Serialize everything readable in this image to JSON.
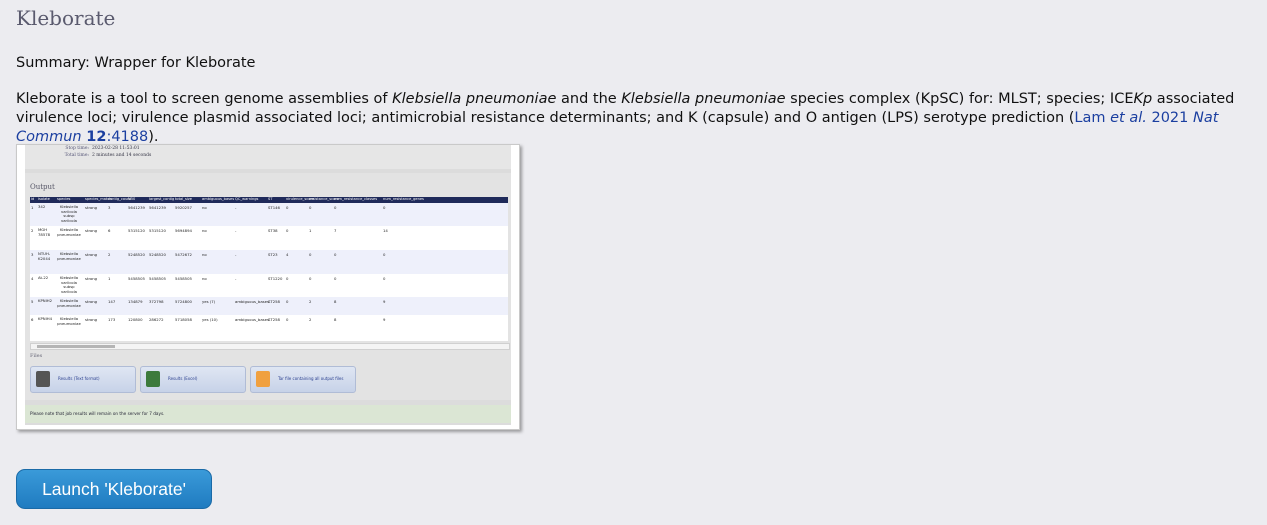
{
  "page": {
    "title": "Kleborate",
    "summary": "Summary: Wrapper for Kleborate",
    "description": {
      "p1": "Kleborate is a tool to screen genome assemblies of ",
      "i1": "Klebsiella pneumoniae",
      "p2": " and the ",
      "i2": "Klebsiella pneumoniae",
      "p3": " species complex (KpSC) for: MLST; species; ICE",
      "i3": "Kp",
      "p4": " associated virulence loci; virulence plasmid associated loci; antimicrobial resistance determinants; and K (capsule) and O antigen (LPS) serotype prediction (",
      "ref_a": "Lam ",
      "ref_b": "et al.",
      "ref_c": " 2021 ",
      "ref_d": "Nat Commun",
      "ref_e": " ",
      "ref_f": "12",
      "ref_g": ":4188",
      "p5": ")."
    },
    "launch_button": "Launch 'Kleborate'"
  },
  "screenshot": {
    "stop_time_label": "Stop time:",
    "stop_time_value": "2023-02-28 11:53:01",
    "total_time_label": "Total time:",
    "total_time_value": "2 minutes and 14 seconds",
    "output_heading": "Output",
    "columns": [
      "id",
      "isolate",
      "species",
      "species_match",
      "contig_count",
      "N50",
      "largest_contig",
      "total_size",
      "ambiguous_bases",
      "QC_warnings",
      "ST",
      "virulence_score",
      "resistance_score",
      "num_resistance_classes",
      "num_resistance_genes"
    ],
    "rows": [
      [
        "1",
        "342",
        "Klebsiella variicola subsp variicola",
        "strong",
        "3",
        "5641239",
        "5641239",
        "5920257",
        "no",
        "-",
        "ST146",
        "0",
        "0",
        "0",
        "0"
      ],
      [
        "2",
        "MGH 78578",
        "Klebsiella pneumoniae",
        "strong",
        "6",
        "5315120",
        "5315120",
        "5694894",
        "no",
        "-",
        "ST38",
        "0",
        "1",
        "7",
        "14"
      ],
      [
        "3",
        "NTUH-K2044",
        "Klebsiella pneumoniae",
        "strong",
        "2",
        "5248520",
        "5248520",
        "5472672",
        "no",
        "-",
        "ST23",
        "4",
        "0",
        "0",
        "0"
      ],
      [
        "4",
        "At-22",
        "Klebsiella variicola subsp variicola",
        "strong",
        "1",
        "5458505",
        "5458505",
        "5458505",
        "no",
        "-",
        "ST1220",
        "0",
        "0",
        "0",
        "0"
      ],
      [
        "5",
        "KPNIH2",
        "Klebsiella pneumoniae",
        "strong",
        "147",
        "134879",
        "372798",
        "5724800",
        "yes (7)",
        "ambiguous_bases",
        "ST258",
        "0",
        "2",
        "8",
        "9"
      ],
      [
        "6",
        "KPNIH4",
        "Klebsiella pneumoniae",
        "strong",
        "173",
        "120800",
        "286272",
        "5718058",
        "yes (10)",
        "ambiguous_bases",
        "ST258",
        "0",
        "2",
        "8",
        "9"
      ]
    ],
    "files_heading": "Files",
    "file_buttons": [
      {
        "label": "Results (Text format)",
        "color": "#555555",
        "icon": "text-file-icon",
        "badge": "Text"
      },
      {
        "label": "Results (Excel)",
        "color": "#3c7a3c",
        "icon": "excel-file-icon",
        "badge": "Excel"
      },
      {
        "label": "Tar file containing all output files",
        "color": "#f0a040",
        "icon": "archive-file-icon",
        "badge": ""
      }
    ],
    "note": "Please note that job results will remain on the server for 7 days."
  },
  "colors": {
    "background": "#ececf0",
    "link": "#1b3fa0",
    "button": "#2a8bcf"
  }
}
